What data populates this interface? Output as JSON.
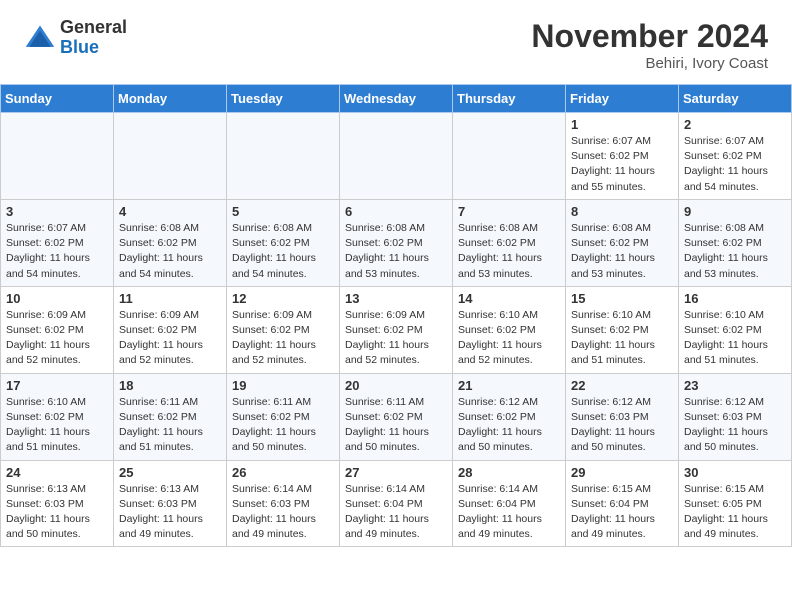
{
  "header": {
    "logo_line1": "General",
    "logo_line2": "Blue",
    "month_title": "November 2024",
    "location": "Behiri, Ivory Coast"
  },
  "weekdays": [
    "Sunday",
    "Monday",
    "Tuesday",
    "Wednesday",
    "Thursday",
    "Friday",
    "Saturday"
  ],
  "weeks": [
    [
      {
        "day": "",
        "info": ""
      },
      {
        "day": "",
        "info": ""
      },
      {
        "day": "",
        "info": ""
      },
      {
        "day": "",
        "info": ""
      },
      {
        "day": "",
        "info": ""
      },
      {
        "day": "1",
        "info": "Sunrise: 6:07 AM\nSunset: 6:02 PM\nDaylight: 11 hours\nand 55 minutes."
      },
      {
        "day": "2",
        "info": "Sunrise: 6:07 AM\nSunset: 6:02 PM\nDaylight: 11 hours\nand 54 minutes."
      }
    ],
    [
      {
        "day": "3",
        "info": "Sunrise: 6:07 AM\nSunset: 6:02 PM\nDaylight: 11 hours\nand 54 minutes."
      },
      {
        "day": "4",
        "info": "Sunrise: 6:08 AM\nSunset: 6:02 PM\nDaylight: 11 hours\nand 54 minutes."
      },
      {
        "day": "5",
        "info": "Sunrise: 6:08 AM\nSunset: 6:02 PM\nDaylight: 11 hours\nand 54 minutes."
      },
      {
        "day": "6",
        "info": "Sunrise: 6:08 AM\nSunset: 6:02 PM\nDaylight: 11 hours\nand 53 minutes."
      },
      {
        "day": "7",
        "info": "Sunrise: 6:08 AM\nSunset: 6:02 PM\nDaylight: 11 hours\nand 53 minutes."
      },
      {
        "day": "8",
        "info": "Sunrise: 6:08 AM\nSunset: 6:02 PM\nDaylight: 11 hours\nand 53 minutes."
      },
      {
        "day": "9",
        "info": "Sunrise: 6:08 AM\nSunset: 6:02 PM\nDaylight: 11 hours\nand 53 minutes."
      }
    ],
    [
      {
        "day": "10",
        "info": "Sunrise: 6:09 AM\nSunset: 6:02 PM\nDaylight: 11 hours\nand 52 minutes."
      },
      {
        "day": "11",
        "info": "Sunrise: 6:09 AM\nSunset: 6:02 PM\nDaylight: 11 hours\nand 52 minutes."
      },
      {
        "day": "12",
        "info": "Sunrise: 6:09 AM\nSunset: 6:02 PM\nDaylight: 11 hours\nand 52 minutes."
      },
      {
        "day": "13",
        "info": "Sunrise: 6:09 AM\nSunset: 6:02 PM\nDaylight: 11 hours\nand 52 minutes."
      },
      {
        "day": "14",
        "info": "Sunrise: 6:10 AM\nSunset: 6:02 PM\nDaylight: 11 hours\nand 52 minutes."
      },
      {
        "day": "15",
        "info": "Sunrise: 6:10 AM\nSunset: 6:02 PM\nDaylight: 11 hours\nand 51 minutes."
      },
      {
        "day": "16",
        "info": "Sunrise: 6:10 AM\nSunset: 6:02 PM\nDaylight: 11 hours\nand 51 minutes."
      }
    ],
    [
      {
        "day": "17",
        "info": "Sunrise: 6:10 AM\nSunset: 6:02 PM\nDaylight: 11 hours\nand 51 minutes."
      },
      {
        "day": "18",
        "info": "Sunrise: 6:11 AM\nSunset: 6:02 PM\nDaylight: 11 hours\nand 51 minutes."
      },
      {
        "day": "19",
        "info": "Sunrise: 6:11 AM\nSunset: 6:02 PM\nDaylight: 11 hours\nand 50 minutes."
      },
      {
        "day": "20",
        "info": "Sunrise: 6:11 AM\nSunset: 6:02 PM\nDaylight: 11 hours\nand 50 minutes."
      },
      {
        "day": "21",
        "info": "Sunrise: 6:12 AM\nSunset: 6:02 PM\nDaylight: 11 hours\nand 50 minutes."
      },
      {
        "day": "22",
        "info": "Sunrise: 6:12 AM\nSunset: 6:03 PM\nDaylight: 11 hours\nand 50 minutes."
      },
      {
        "day": "23",
        "info": "Sunrise: 6:12 AM\nSunset: 6:03 PM\nDaylight: 11 hours\nand 50 minutes."
      }
    ],
    [
      {
        "day": "24",
        "info": "Sunrise: 6:13 AM\nSunset: 6:03 PM\nDaylight: 11 hours\nand 50 minutes."
      },
      {
        "day": "25",
        "info": "Sunrise: 6:13 AM\nSunset: 6:03 PM\nDaylight: 11 hours\nand 49 minutes."
      },
      {
        "day": "26",
        "info": "Sunrise: 6:14 AM\nSunset: 6:03 PM\nDaylight: 11 hours\nand 49 minutes."
      },
      {
        "day": "27",
        "info": "Sunrise: 6:14 AM\nSunset: 6:04 PM\nDaylight: 11 hours\nand 49 minutes."
      },
      {
        "day": "28",
        "info": "Sunrise: 6:14 AM\nSunset: 6:04 PM\nDaylight: 11 hours\nand 49 minutes."
      },
      {
        "day": "29",
        "info": "Sunrise: 6:15 AM\nSunset: 6:04 PM\nDaylight: 11 hours\nand 49 minutes."
      },
      {
        "day": "30",
        "info": "Sunrise: 6:15 AM\nSunset: 6:05 PM\nDaylight: 11 hours\nand 49 minutes."
      }
    ]
  ]
}
